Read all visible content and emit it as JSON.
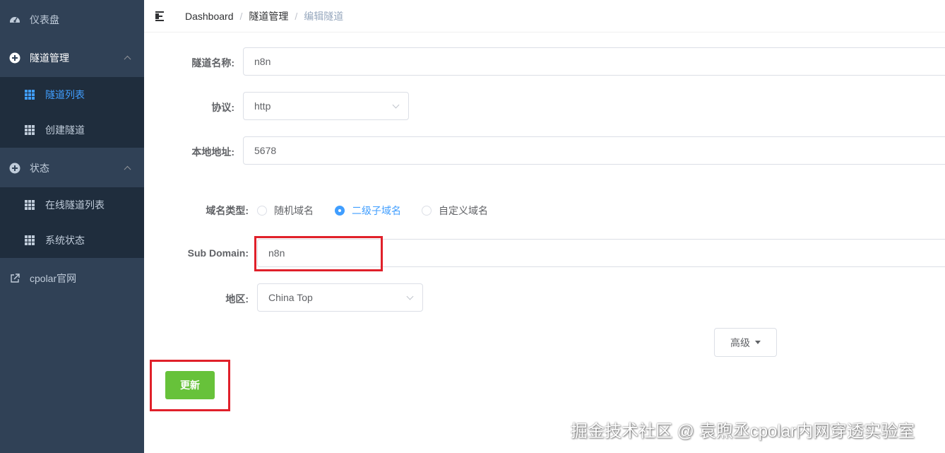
{
  "sidebar": {
    "items": [
      {
        "label": "仪表盘",
        "icon": "dashboard-icon"
      },
      {
        "label": "隧道管理",
        "icon": "plus-circle-icon"
      },
      {
        "label": "隧道列表",
        "icon": "grid-icon"
      },
      {
        "label": "创建隧道",
        "icon": "grid-icon"
      },
      {
        "label": "状态",
        "icon": "plus-circle-icon"
      },
      {
        "label": "在线隧道列表",
        "icon": "grid-icon"
      },
      {
        "label": "系统状态",
        "icon": "grid-icon"
      },
      {
        "label": "cpolar官网",
        "icon": "external-link-icon"
      }
    ]
  },
  "breadcrumb": {
    "items": [
      "Dashboard",
      "隧道管理",
      "编辑隧道"
    ],
    "separator": "/"
  },
  "form": {
    "tunnel_name": {
      "label": "隧道名称:",
      "value": "n8n"
    },
    "protocol": {
      "label": "协议:",
      "value": "http"
    },
    "local_address": {
      "label": "本地地址:",
      "value": "5678"
    },
    "domain_type": {
      "label": "域名类型:",
      "options": [
        "随机域名",
        "二级子域名",
        "自定义域名"
      ],
      "selected": "二级子域名"
    },
    "sub_domain": {
      "label": "Sub Domain:",
      "value": "n8n"
    },
    "region": {
      "label": "地区:",
      "value": "China Top"
    },
    "advanced_label": "高级",
    "update_label": "更新"
  },
  "watermark": "掘金技术社区 @ 袁煦丞cpolar内网穿透实验室",
  "colors": {
    "sidebar_bg": "#304156",
    "submenu_bg": "#1f2d3d",
    "active": "#409eff",
    "update_button": "#67c23a",
    "highlight": "#e0202a"
  }
}
